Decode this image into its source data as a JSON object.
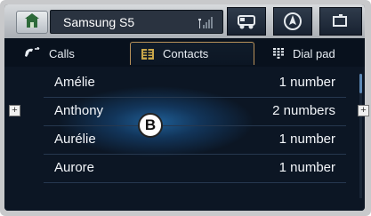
{
  "header": {
    "device_name": "Samsung S5"
  },
  "tabs": [
    {
      "label": "Calls",
      "icon": "phone-icon",
      "active": false
    },
    {
      "label": "Contacts",
      "icon": "contacts-icon",
      "active": true
    },
    {
      "label": "Dial pad",
      "icon": "keypad-icon",
      "active": false
    }
  ],
  "contacts": [
    {
      "name": "Amélie",
      "count": "1 number"
    },
    {
      "name": "Anthony",
      "count": "2 numbers"
    },
    {
      "name": "Aurélie",
      "count": "1 number"
    },
    {
      "name": "Aurore",
      "count": "1 number"
    }
  ],
  "badge": "B",
  "colors": {
    "screen_bg": "#0c1624",
    "header_bg": "#b9bfc6",
    "tab_accent": "#b9925a",
    "highlight": "#1f5e95"
  }
}
